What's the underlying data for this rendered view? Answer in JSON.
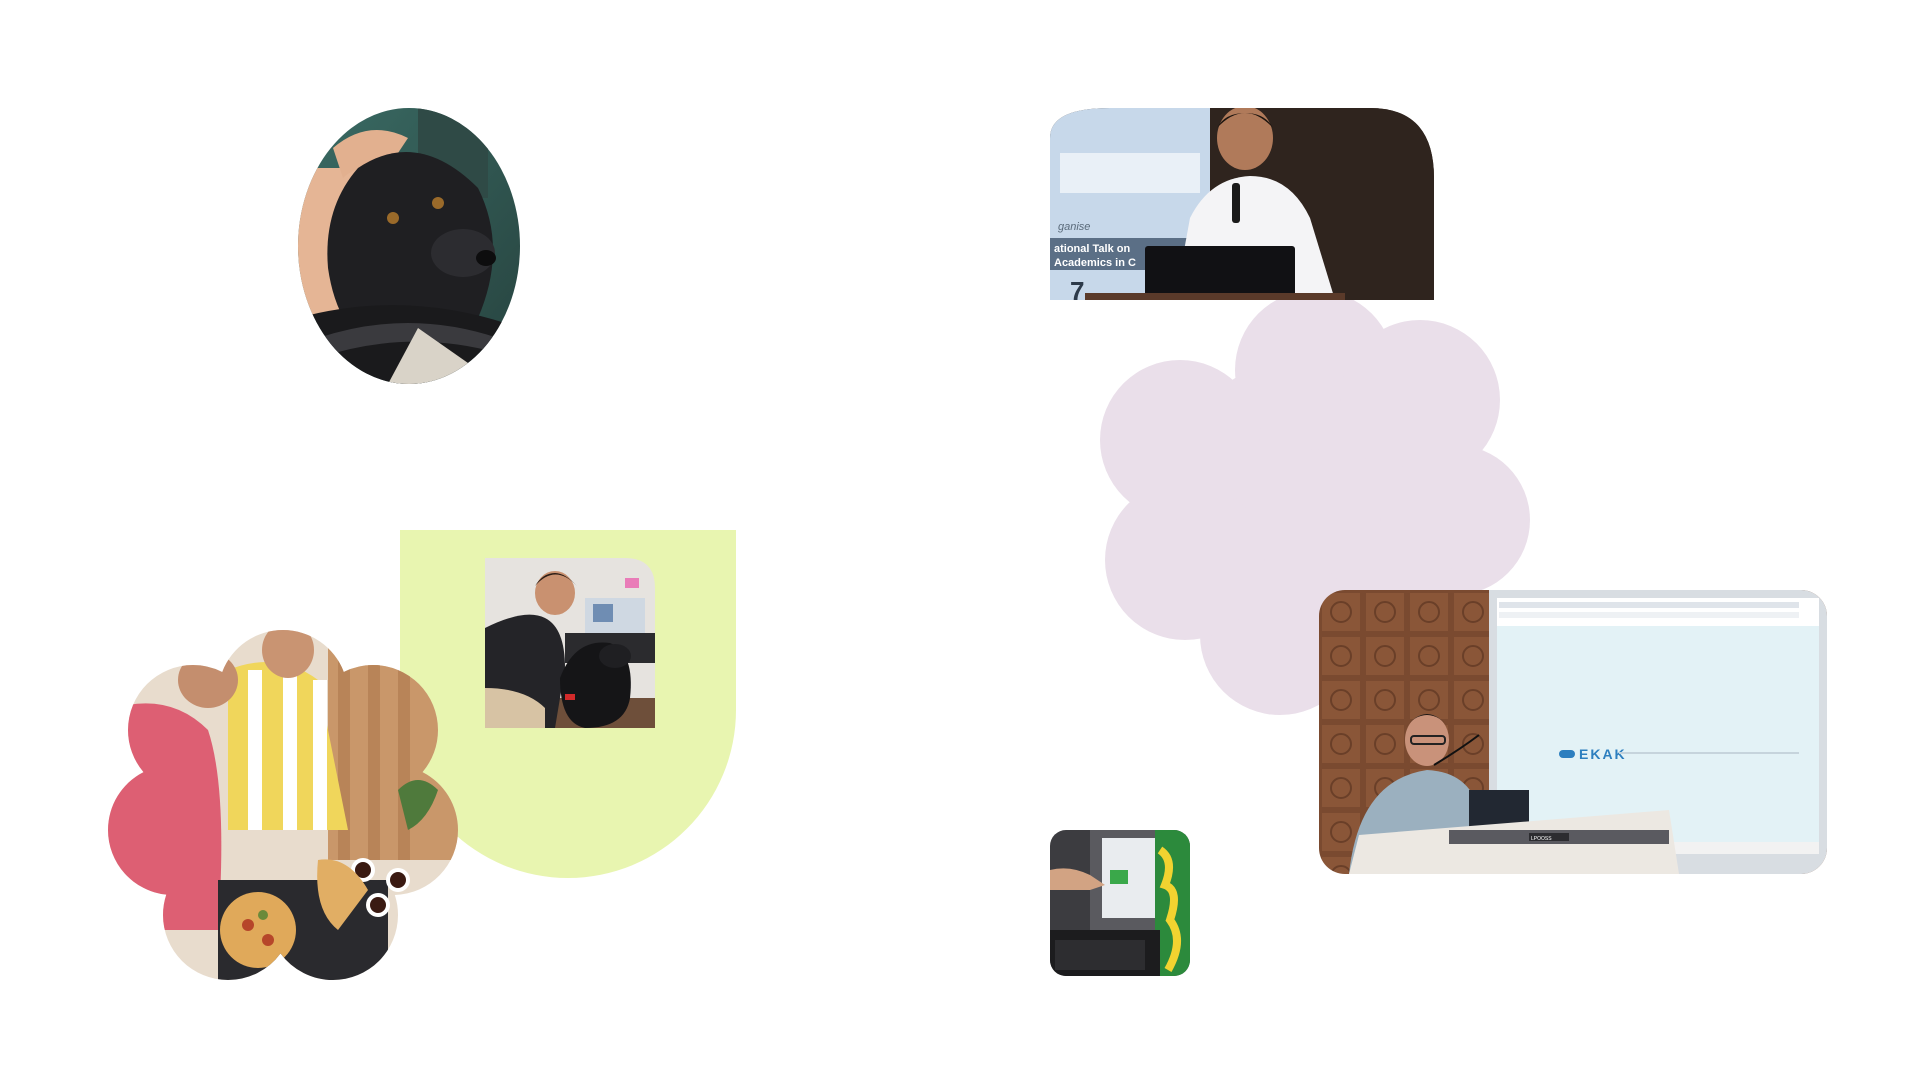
{
  "gallery": {
    "background": "#ffffff",
    "shape_colors": {
      "lime": "#e8f5b0",
      "lavender": "#eadfea"
    },
    "photos": [
      {
        "name": "photo-dog-portrait",
        "subject": "black dog held by a person"
      },
      {
        "name": "photo-speaker-podium",
        "subject": "speaker with microphone at a podium"
      },
      {
        "name": "photo-man-with-dog",
        "subject": "man crouching next to a black dog in an office"
      },
      {
        "name": "photo-team-pizza",
        "subject": "team sharing pizza and drinks"
      },
      {
        "name": "photo-presenter-screen",
        "subject": "presenter at a lectern in front of a projection screen"
      },
      {
        "name": "photo-computer-screen",
        "subject": "hand pointing at a computer monitor"
      }
    ],
    "slide_lines": [
      "ganise",
      "ational Talk on",
      "Academics in C"
    ],
    "projection_brand": "EKAK",
    "lectern_label": "LPOOSS"
  }
}
